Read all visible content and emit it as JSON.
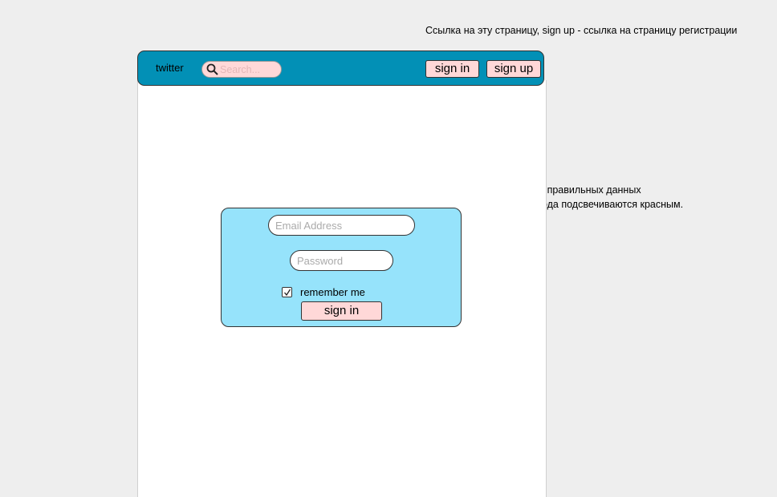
{
  "annotations": {
    "top_note": "Ссылка на эту страницу, sign up - ссылка на страницу регистрации",
    "side_note_line1": "при вводе неправильных данных",
    "side_note_line2": "поля для ввода подсвечиваются красным."
  },
  "navbar": {
    "brand": "twitter",
    "search_placeholder": "Search...",
    "search_icon": "search-icon",
    "sign_in_label": "sign in",
    "sign_up_label": "sign up"
  },
  "login_form": {
    "email_placeholder": "Email Address",
    "password_placeholder": "Password",
    "remember_label": "remember me",
    "remember_checked": true,
    "submit_label": "sign in"
  },
  "colors": {
    "background": "#eeeeee",
    "navbar": "#0290b6",
    "form_panel": "#96e3fb",
    "button": "#ffd8d8"
  }
}
